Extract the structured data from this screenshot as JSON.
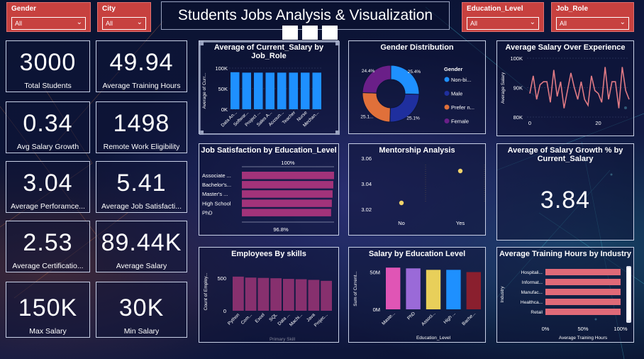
{
  "filters": {
    "gender": {
      "label": "Gender",
      "value": "All"
    },
    "city": {
      "label": "City",
      "value": "All"
    },
    "education": {
      "label": "Education_Level",
      "value": "All"
    },
    "job_role": {
      "label": "Job_Role",
      "value": "All"
    }
  },
  "title": "Students Jobs Analysis & Visualization",
  "kpis": {
    "total_students": {
      "value": "3000",
      "label": "Total Students"
    },
    "avg_training_hours": {
      "value": "49.94",
      "label": "Average Training Hours"
    },
    "avg_salary_growth": {
      "value": "0.34",
      "label": "Avg Salary Growth"
    },
    "remote_work": {
      "value": "1498",
      "label": "Remote Work Eligibility"
    },
    "avg_performance": {
      "value": "3.04",
      "label": "Average Perforamce..."
    },
    "avg_job_satisfaction": {
      "value": "5.41",
      "label": "Average Job Satisfacti..."
    },
    "avg_certification": {
      "value": "2.53",
      "label": "Average Certificatio..."
    },
    "avg_salary": {
      "value": "89.44K",
      "label": "Average Salary"
    },
    "max_salary": {
      "value": "150K",
      "label": "Max Salary"
    },
    "min_salary": {
      "value": "30K",
      "label": "Min Salary"
    }
  },
  "colors": {
    "accent_red": "#c7413f",
    "bar_blue": "#1e90ff",
    "bar_magenta": "#a2337a",
    "bar_purple": "#87306e",
    "bar_salmon": "#e06a78",
    "line_salmon": "#e07a84"
  },
  "chart_data": [
    {
      "id": "salary_by_job_role",
      "type": "bar",
      "title": "Average of Current_Salary by Job_Role",
      "ylabel": "Average of Curr...",
      "yticks": [
        "0K",
        "50K",
        "100K"
      ],
      "categories": [
        "Data An...",
        "Softwar...",
        "Project ...",
        "Sales A...",
        "Accoun...",
        "Teacher",
        "Nurse",
        "Mechan..."
      ],
      "values": [
        90,
        89,
        89,
        89,
        89,
        89,
        89,
        89
      ],
      "ylim": [
        0,
        100
      ]
    },
    {
      "id": "gender_distribution",
      "type": "pie",
      "title": "Gender Distribution",
      "legend_title": "Gender",
      "labels": [
        "Non-bi...",
        "Male",
        "Prefer n...",
        "Female"
      ],
      "values": [
        25.4,
        25.1,
        25.1,
        24.4
      ],
      "data_labels": [
        "25.4%",
        "25.1%",
        "25.1...",
        "24.4%"
      ],
      "colors": [
        "#1e90ff",
        "#1f2f9e",
        "#e0703a",
        "#6a1f88"
      ]
    },
    {
      "id": "salary_over_experience",
      "type": "line",
      "title": "Average Salary Over Experience",
      "ylabel": "Average Salary",
      "yticks": [
        "80K",
        "90K",
        "100K"
      ],
      "xticks": [
        "0",
        "20"
      ],
      "x": [
        0,
        1,
        2,
        3,
        4,
        5,
        6,
        7,
        8,
        9,
        10,
        11,
        12,
        13,
        14,
        15,
        16,
        17,
        18,
        19,
        20,
        21,
        22,
        23,
        24,
        25,
        26,
        27,
        28,
        29
      ],
      "values": [
        88,
        94,
        86,
        91,
        92,
        92,
        85,
        96,
        87,
        92,
        83,
        89,
        95,
        90,
        86,
        92,
        86,
        84,
        94,
        89,
        88,
        85,
        97,
        86,
        92,
        92,
        83,
        97,
        89,
        86
      ],
      "ylim": [
        80,
        100
      ]
    },
    {
      "id": "job_satisfaction_by_education",
      "type": "bar",
      "title": "Job Satisfaction by Education_Level",
      "categories": [
        "Associate ...",
        "Bachelor's...",
        "Master's ...",
        "High School",
        "PhD"
      ],
      "values": [
        100,
        99.2,
        98.4,
        97.6,
        96.8
      ],
      "data_labels": {
        "top": "100%",
        "bottom": "96.8%"
      }
    },
    {
      "id": "mentorship_analysis",
      "type": "scatter",
      "title": "Mentorship Analysis",
      "categories": [
        "No",
        "Yes"
      ],
      "values": [
        3.025,
        3.05
      ],
      "yticks": [
        "3.02",
        "3.04",
        "3.06"
      ],
      "ylim": [
        3.01,
        3.06
      ]
    },
    {
      "id": "salary_growth_by_salary",
      "type": "card",
      "title": "Average of Salary Growth % by Current_Salary",
      "value": "3.84"
    },
    {
      "id": "employees_by_skills",
      "type": "bar",
      "title": "Employees By skills",
      "ylabel": "Count of Employ...",
      "xlabel": "Primary Skill",
      "yticks": [
        "0",
        "500"
      ],
      "categories": [
        "Python",
        "Com...",
        "Excel",
        "SQL",
        "Data ...",
        "Machi...",
        "Java",
        "Projec..."
      ],
      "values": [
        525,
        510,
        505,
        500,
        490,
        485,
        475,
        460
      ],
      "ylim": [
        0,
        600
      ]
    },
    {
      "id": "salary_by_education",
      "type": "bar",
      "title": "Salary by Education Level",
      "ylabel": "Sum of Current...",
      "xlabel": "Education_Level",
      "yticks": [
        "0M",
        "50M"
      ],
      "categories": [
        "Maste...",
        "PhD",
        "Associ...",
        "High ...",
        "Bache..."
      ],
      "values": [
        56,
        55,
        53,
        53,
        50
      ],
      "colors": [
        "#e055b5",
        "#9a6ad8",
        "#e8cf5a",
        "#1e90ff",
        "#8a1f2e"
      ],
      "ylim": [
        0,
        60
      ]
    },
    {
      "id": "training_hours_by_industry",
      "type": "bar",
      "title": "Average Training Hours by Industry",
      "ylabel": "Industry",
      "xlabel": "Average Training Hours",
      "xticks": [
        "0%",
        "50%",
        "100%"
      ],
      "categories": [
        "Hospitali...",
        "Informat...",
        "Manufac...",
        "Healthca...",
        "Retail"
      ],
      "values": [
        100,
        100,
        100,
        100,
        100
      ]
    }
  ]
}
